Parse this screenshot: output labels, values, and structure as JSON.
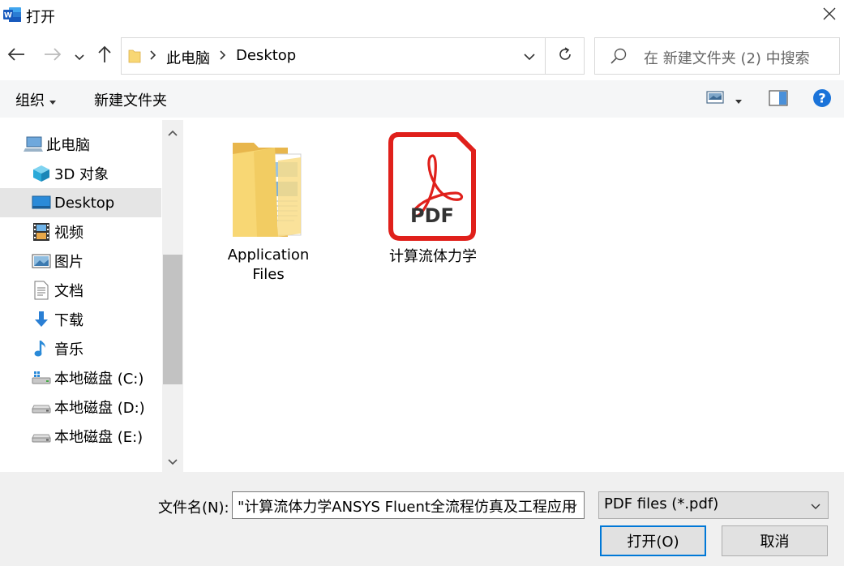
{
  "window": {
    "title": "打开",
    "app_icon": "word-icon"
  },
  "address": {
    "segments": [
      "此电脑",
      "Desktop"
    ],
    "search_placeholder": "在 新建文件夹 (2) 中搜索"
  },
  "toolbar": {
    "organize_label": "组织",
    "new_folder_label": "新建文件夹"
  },
  "nav": {
    "items": [
      {
        "label": "此电脑",
        "icon": "computer-icon"
      },
      {
        "label": "3D 对象",
        "icon": "3d-objects-icon"
      },
      {
        "label": "Desktop",
        "icon": "desktop-icon",
        "selected": true
      },
      {
        "label": "视频",
        "icon": "video-icon"
      },
      {
        "label": "图片",
        "icon": "pictures-icon"
      },
      {
        "label": "文档",
        "icon": "documents-icon"
      },
      {
        "label": "下载",
        "icon": "download-icon"
      },
      {
        "label": "音乐",
        "icon": "music-icon"
      },
      {
        "label": "本地磁盘 (C:)",
        "icon": "drive-c-icon"
      },
      {
        "label": "本地磁盘 (D:)",
        "icon": "drive-icon"
      },
      {
        "label": "本地磁盘 (E:)",
        "icon": "drive-icon"
      }
    ]
  },
  "files": [
    {
      "name_line1": "Application",
      "name_line2": "Files",
      "icon": "folder-icon"
    },
    {
      "name_line1": "计算流体力学",
      "icon": "pdf-icon"
    }
  ],
  "bottom": {
    "filename_label": "文件名(N):",
    "filename_value": "\"计算流体力学ANSYS Fluent全流程仿真及工程应用",
    "filetype_value": "PDF files (*.pdf)",
    "open_label": "打开(O)",
    "cancel_label": "取消"
  },
  "colors": {
    "accent": "#0078d7",
    "pdf_red": "#e0201b",
    "folder": "#f8d774"
  }
}
